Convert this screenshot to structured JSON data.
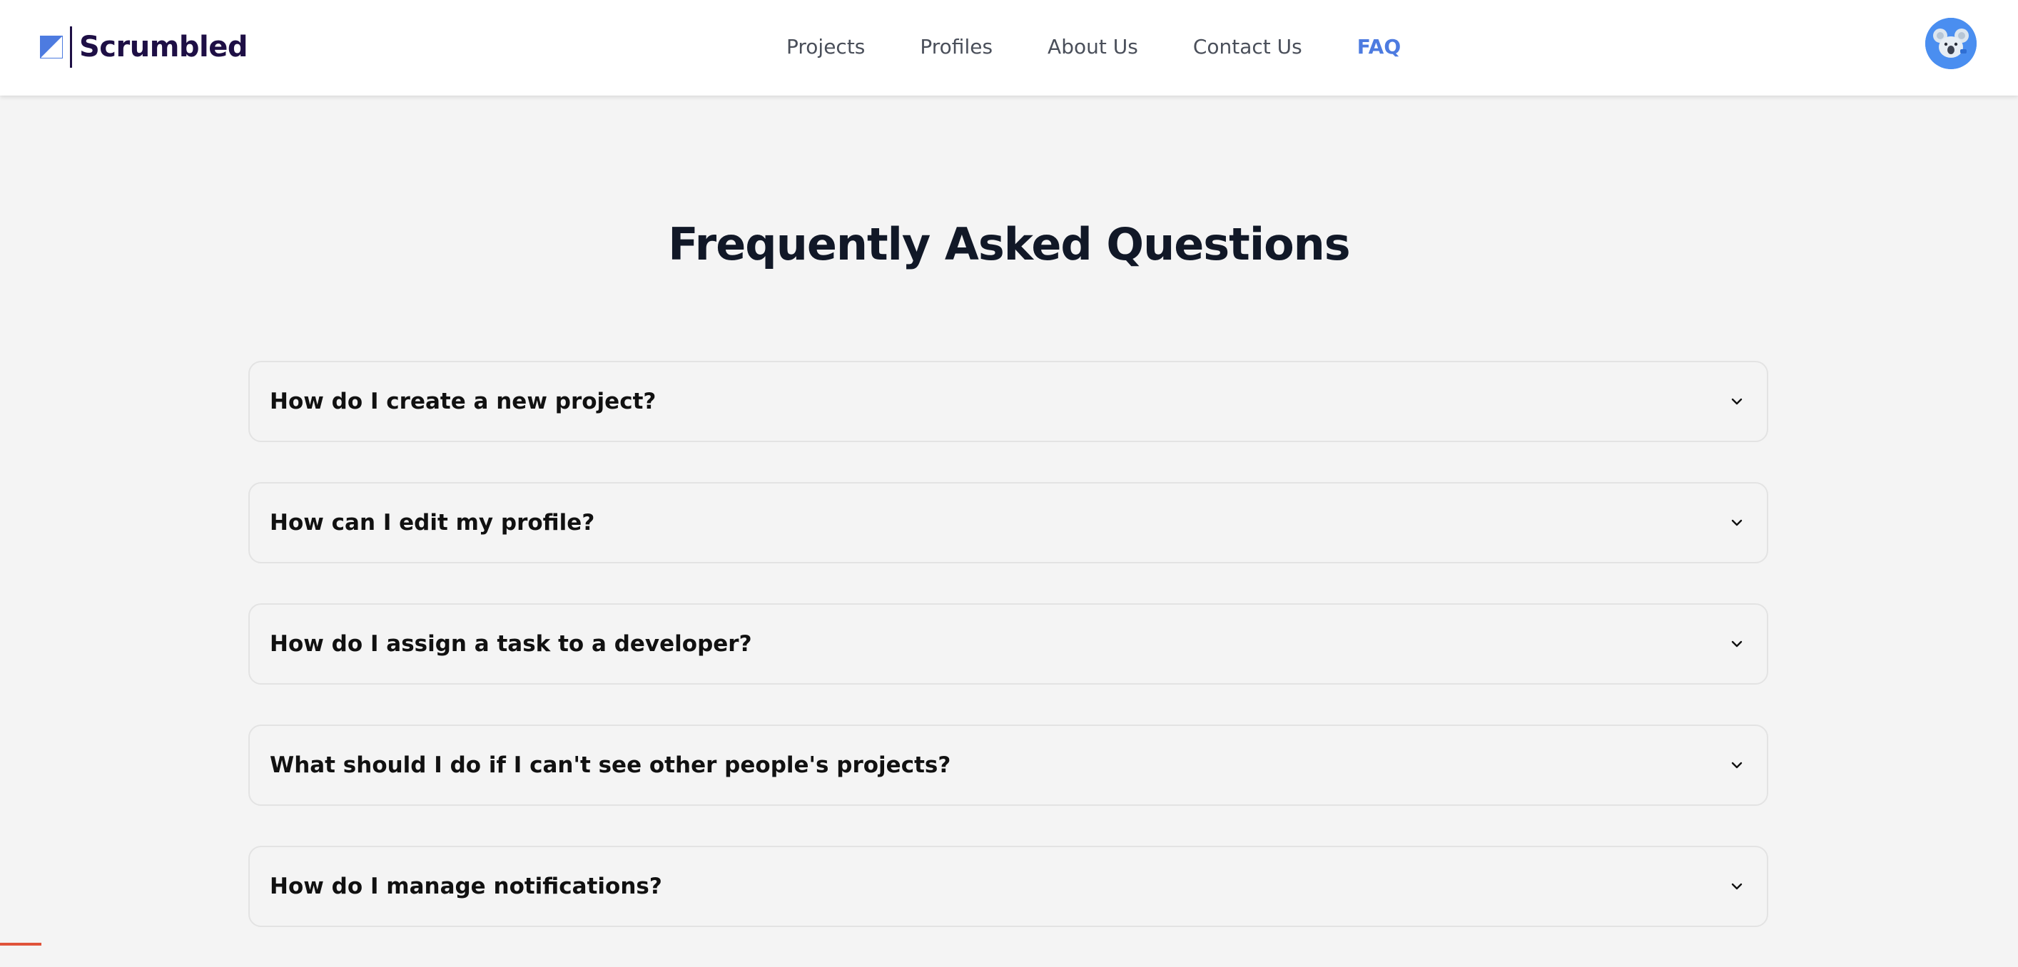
{
  "brand": {
    "name": "Scrumbled",
    "logo_icon": "half-square-logo-icon",
    "color": "#1e0f45",
    "accent": "#4d7be0"
  },
  "nav": {
    "items": [
      {
        "label": "Projects",
        "active": false
      },
      {
        "label": "Profiles",
        "active": false
      },
      {
        "label": "About Us",
        "active": false
      },
      {
        "label": "Contact Us",
        "active": false
      },
      {
        "label": "FAQ",
        "active": true
      }
    ],
    "active_color": "#4d7be0"
  },
  "user": {
    "avatar_icon": "koala-avatar-icon",
    "avatar_color": "#4a8ef0"
  },
  "main": {
    "title": "Frequently Asked Questions",
    "faqs": [
      {
        "question": "How do I create a new project?",
        "expanded": false,
        "icon": "chevron-down-icon"
      },
      {
        "question": "How can I edit my profile?",
        "expanded": false,
        "icon": "chevron-down-icon"
      },
      {
        "question": "How do I assign a task to a developer?",
        "expanded": false,
        "icon": "chevron-down-icon"
      },
      {
        "question": "What should I do if I can't see other people's projects?",
        "expanded": false,
        "icon": "chevron-down-icon"
      },
      {
        "question": "How do I manage notifications?",
        "expanded": false,
        "icon": "chevron-down-icon"
      }
    ]
  }
}
